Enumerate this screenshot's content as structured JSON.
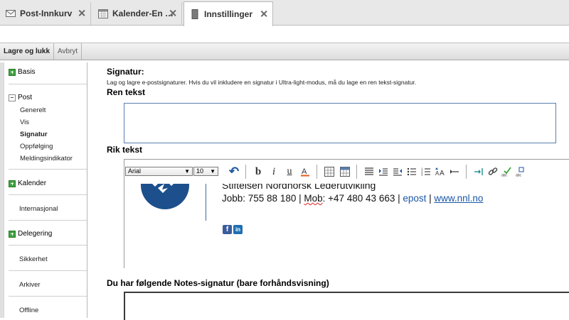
{
  "tabs": [
    {
      "label": "Post-Innkurv",
      "icon": "mail-icon"
    },
    {
      "label": "Kalender-En …",
      "icon": "calendar-icon"
    },
    {
      "label": "Innstillinger",
      "icon": "settings-page-icon",
      "active": true
    }
  ],
  "toolbar": {
    "save_close": "Lagre og lukk",
    "cancel": "Avbryt"
  },
  "nav": {
    "basis": "Basis",
    "post": "Post",
    "post_items": [
      "Generelt",
      "Vis",
      "Signatur",
      "Oppfølging",
      "Meldingsindikator"
    ],
    "kalender": "Kalender",
    "internasjonal": "Internasjonal",
    "delegering": "Delegering",
    "sikkerhet": "Sikkerhet",
    "arkiver": "Arkiver",
    "offline": "Offline"
  },
  "content": {
    "signature_heading": "Signatur:",
    "description": "Lag og lagre e-postsignaturer. Hvis du vil inkludere en signatur i Ultra-light-modus, må du lage en ren tekst-signatur.",
    "plain_heading": "Ren tekst",
    "plain_value": "",
    "rich_heading": "Rik tekst",
    "font_value": "Arial",
    "size_value": "10",
    "signature": {
      "line1": "Stiftelsen Nordnorsk Lederutvikling",
      "jobb_label": "Jobb: 755 88 180 | ",
      "mob_label": "Mob",
      "mob_value": ": +47 480 43 663 | ",
      "epost": "epost",
      "sep": " | ",
      "website": "www.nnl.no",
      "facebook": "f",
      "linkedin": "in"
    },
    "notes_heading": "Du har følgende Notes-signatur (bare forhåndsvisning)"
  },
  "colors": {
    "accent_green": "#3fa33f",
    "link_blue": "#1a57a8",
    "logo_blue": "#1c4f8c"
  }
}
